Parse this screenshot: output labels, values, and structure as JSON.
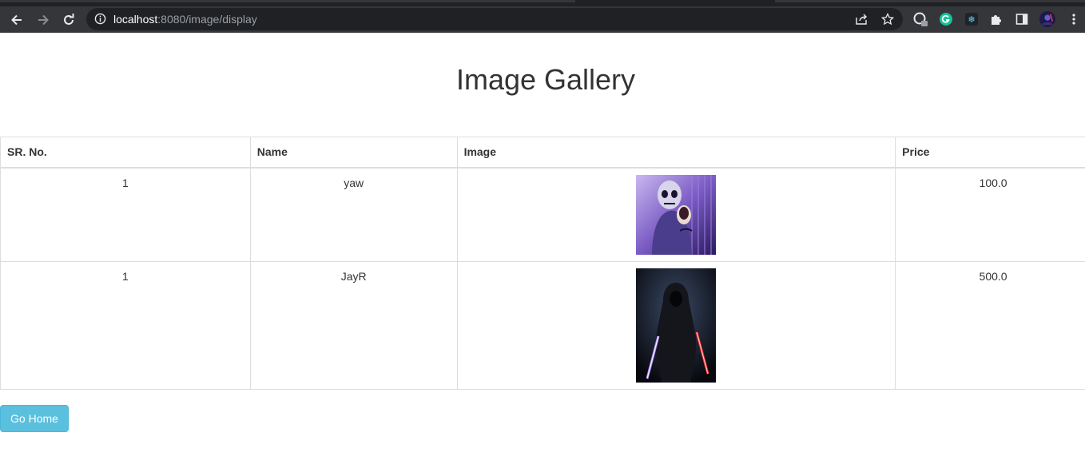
{
  "browser": {
    "url_host": "localhost",
    "url_path": ":8080/image/display"
  },
  "page": {
    "title": "Image Gallery"
  },
  "table": {
    "headers": [
      "SR. No.",
      "Name",
      "Image",
      "Price"
    ],
    "rows": [
      {
        "sr": "1",
        "name": "yaw",
        "image": "skeleton-figure-image",
        "price": "100.0"
      },
      {
        "sr": "1",
        "name": "JayR",
        "image": "hooded-sith-image",
        "price": "500.0"
      }
    ]
  },
  "buttons": {
    "go_home": "Go Home"
  },
  "colors": {
    "button_bg": "#5bc0de",
    "border": "#dddddd",
    "chrome_bg": "#35363a"
  }
}
